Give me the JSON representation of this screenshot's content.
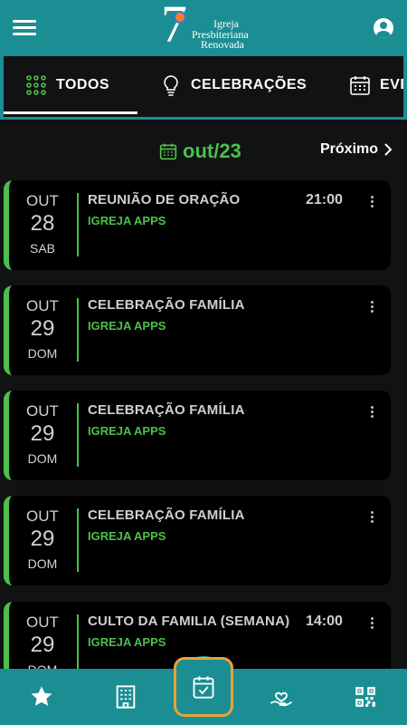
{
  "header": {
    "logo_line1": "Igreja",
    "logo_line2": "Presbiteriana",
    "logo_line3": "Renovada",
    "logo_numeral": "7"
  },
  "tabs": [
    {
      "label": "TODOS",
      "icon": "grid-dots-icon",
      "active": true
    },
    {
      "label": "CELEBRAÇÕES",
      "icon": "lightbulb-icon",
      "active": false
    },
    {
      "label": "EVE",
      "icon": "calendar-icon",
      "active": false
    }
  ],
  "month_nav": {
    "month_label": "out/23",
    "next_label": "Próximo"
  },
  "events": [
    {
      "month": "OUT",
      "day": "28",
      "weekday": "SAB",
      "title": "REUNIÃO DE ORAÇÃO",
      "org": "IGREJA APPS",
      "time": "21:00"
    },
    {
      "month": "OUT",
      "day": "29",
      "weekday": "DOM",
      "title": "CELEBRAÇÃO FAMÍLIA",
      "org": "IGREJA APPS",
      "time": ""
    },
    {
      "month": "OUT",
      "day": "29",
      "weekday": "DOM",
      "title": "CELEBRAÇÃO FAMÍLIA",
      "org": "IGREJA APPS",
      "time": ""
    },
    {
      "month": "OUT",
      "day": "29",
      "weekday": "DOM",
      "title": "CELEBRAÇÃO FAMÍLIA",
      "org": "IGREJA APPS",
      "time": ""
    },
    {
      "month": "OUT",
      "day": "29",
      "weekday": "DOM",
      "title": "CULTO DA FAMILIA (SEMANA)",
      "org": "IGREJA APPS",
      "time": "14:00"
    }
  ],
  "bottom_nav": [
    {
      "icon": "star-icon"
    },
    {
      "icon": "building-icon"
    },
    {
      "icon": "calendar-check-icon",
      "active": true
    },
    {
      "icon": "hand-heart-icon"
    },
    {
      "icon": "qr-code-icon"
    }
  ],
  "colors": {
    "teal": "#1b8e93",
    "green": "#4cc04a",
    "card": "#000000",
    "background": "#111214",
    "active_border": "#e8a23a"
  }
}
